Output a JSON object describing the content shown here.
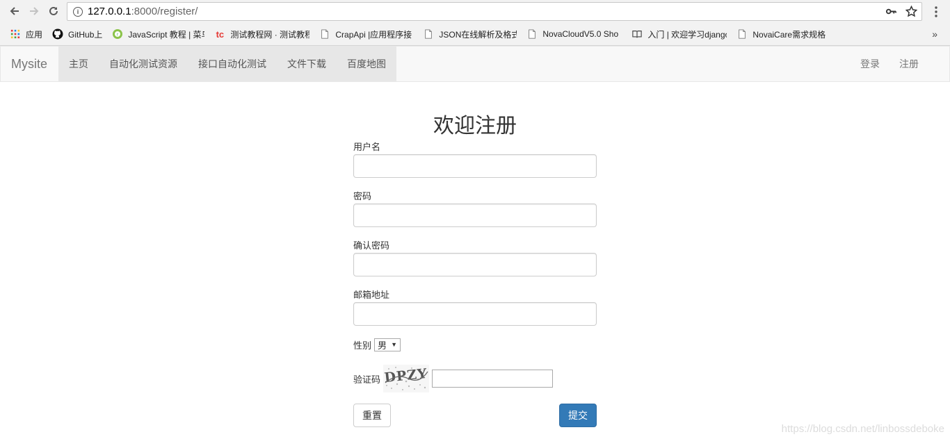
{
  "browser": {
    "url_host": "127.0.0.1",
    "url_rest": ":8000/register/",
    "bookmarks": [
      {
        "label": "应用",
        "icon": "apps-grid-icon"
      },
      {
        "label": "GitHub上",
        "icon": "github-icon"
      },
      {
        "label": "JavaScript 教程 | 菜鸟",
        "icon": "runoob-icon"
      },
      {
        "label": "测试教程网 · 测试教程",
        "icon": "tc-icon"
      },
      {
        "label": "CrapApi |应用程序接",
        "icon": "page-icon"
      },
      {
        "label": "JSON在线解析及格式",
        "icon": "page-icon"
      },
      {
        "label": "NovaCloudV5.0 Sho",
        "icon": "page-icon"
      },
      {
        "label": "入门 | 欢迎学习django",
        "icon": "book-icon"
      },
      {
        "label": "NovaiCare需求规格",
        "icon": "page-icon"
      }
    ],
    "more": "»"
  },
  "navbar": {
    "brand": "Mysite",
    "items": [
      "主页",
      "自动化测试资源",
      "接口自动化测试",
      "文件下载",
      "百度地图"
    ],
    "login": "登录",
    "register": "注册"
  },
  "form": {
    "title": "欢迎注册",
    "username_label": "用户名",
    "password_label": "密码",
    "confirm_label": "确认密码",
    "email_label": "邮箱地址",
    "gender_label": "性别",
    "gender_value": "男",
    "captcha_label": "验证码",
    "captcha_text": "DPZY",
    "reset_label": "重置",
    "submit_label": "提交"
  },
  "watermark": "https://blog.csdn.net/linbossdeboke",
  "colors": {
    "primary": "#337ab7",
    "navbar_bg": "#f8f8f8",
    "nav_active_bg": "#e7e7e7"
  }
}
